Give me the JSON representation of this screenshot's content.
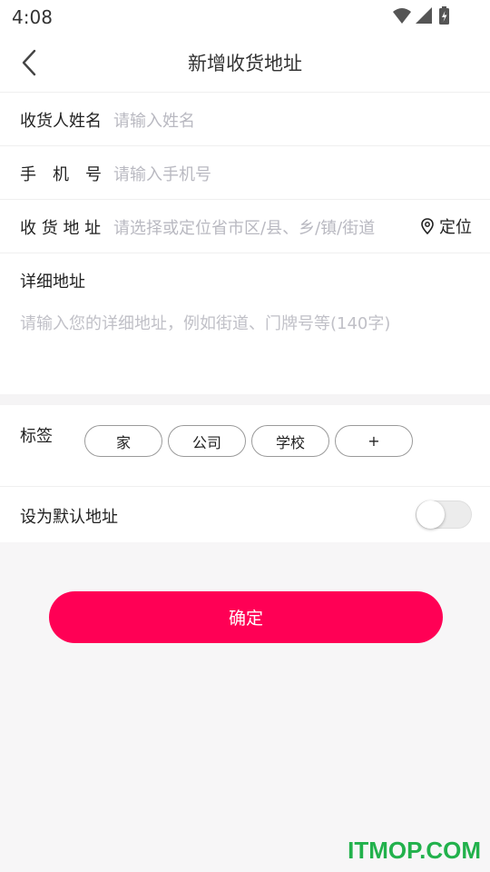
{
  "status": {
    "time": "4:08"
  },
  "header": {
    "title": "新增收货地址"
  },
  "form": {
    "name": {
      "label": "收货人姓名",
      "placeholder": "请输入姓名"
    },
    "phone": {
      "label": "手　机　号",
      "placeholder": "请输入手机号"
    },
    "region": {
      "label": "收 货 地 址",
      "placeholder": "请选择或定位省市区/县、乡/镇/街道",
      "locate_label": "定位"
    },
    "detail": {
      "label": "详细地址",
      "placeholder": "请输入您的详细地址，例如街道、门牌号等(140字)"
    }
  },
  "tags": {
    "label": "标签",
    "items": [
      "家",
      "公司",
      "学校",
      "+"
    ]
  },
  "default_address": {
    "label": "设为默认地址",
    "enabled": false
  },
  "confirm_label": "确定",
  "watermark": "ITMOP.COM",
  "colors": {
    "accent": "#ff0055",
    "watermark": "#22b14c"
  }
}
